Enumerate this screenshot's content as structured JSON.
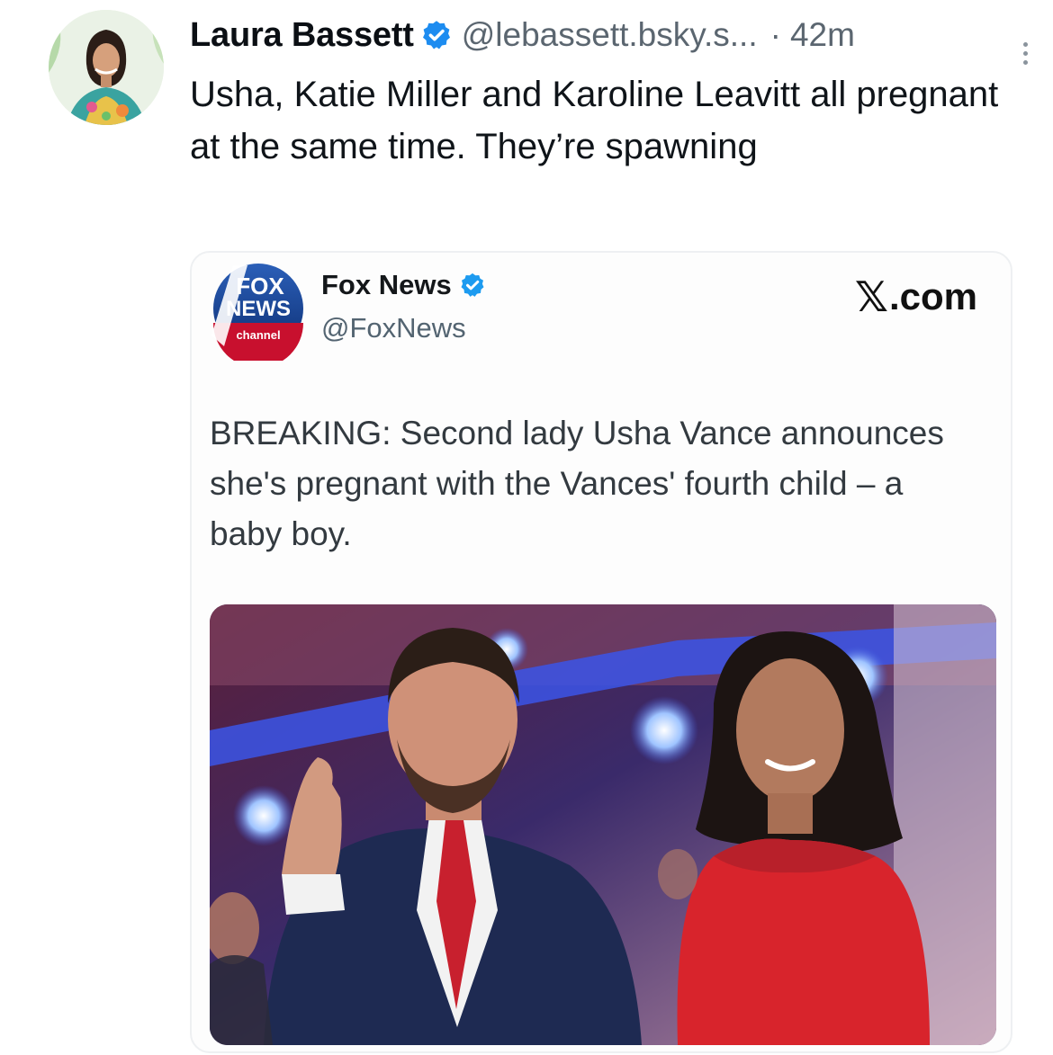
{
  "post": {
    "author_name": "Laura Bassett",
    "author_handle": "@lebassett.bsky.s...",
    "separator": "·",
    "timestamp": "42m",
    "text": "Usha, Katie Miller and Karoline Leavitt all pregnant at the same time. They’re spawning"
  },
  "embed": {
    "source_name": "Fox News",
    "source_handle": "@FoxNews",
    "site_mark": "𝕏",
    "site_suffix": ".com",
    "logo_text": {
      "line1": "FOX",
      "line2": "NEWS",
      "line3": "channel"
    },
    "body": "BREAKING: Second lady Usha Vance announces she's pregnant with the Vances' fourth child – a baby boy."
  },
  "icons": {
    "verified": "verified-check-icon",
    "more": "more-options-icon"
  },
  "colors": {
    "verified_blue": "#1d8cf0",
    "fox_blue": "#0d3b8c",
    "fox_red": "#c8102e",
    "handle_gray": "#5b6670"
  }
}
